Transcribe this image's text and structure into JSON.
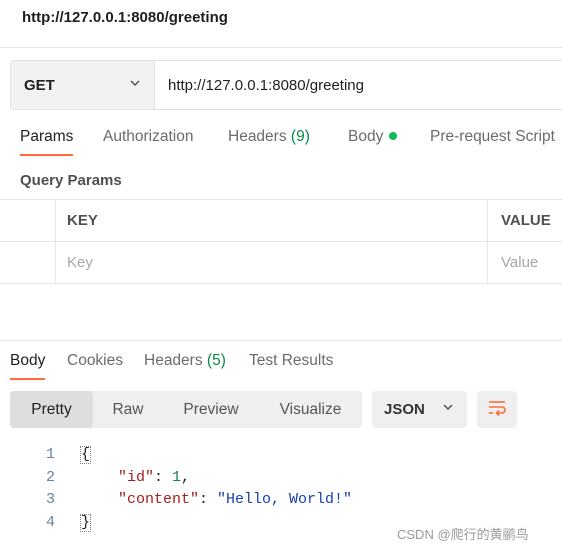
{
  "request": {
    "title": "http://127.0.0.1:8080/greeting",
    "method": "GET",
    "url": "http://127.0.0.1:8080/greeting"
  },
  "request_tabs": {
    "params": "Params",
    "authorization": "Authorization",
    "headers": "Headers",
    "headers_count": "(9)",
    "body": "Body",
    "prerequest": "Pre-request Script"
  },
  "query_params": {
    "label": "Query Params",
    "columns": {
      "key": "KEY",
      "value": "VALUE"
    },
    "placeholders": {
      "key": "Key",
      "value": "Value"
    }
  },
  "response_tabs": {
    "body": "Body",
    "cookies": "Cookies",
    "headers": "Headers",
    "headers_count": "(5)",
    "test_results": "Test Results"
  },
  "view_modes": {
    "pretty": "Pretty",
    "raw": "Raw",
    "preview": "Preview",
    "visualize": "Visualize",
    "active": "Pretty"
  },
  "format": "JSON",
  "response_lines": [
    {
      "num": "1",
      "text": "{"
    },
    {
      "num": "2",
      "key": "\"id\"",
      "colon": ": ",
      "value": "1",
      "tail": ","
    },
    {
      "num": "3",
      "key": "\"content\"",
      "colon": ": ",
      "value": "\"Hello, World!\""
    },
    {
      "num": "4",
      "text": "}"
    }
  ],
  "watermark": "CSDN @爬行的黄鹂鸟",
  "colors": {
    "accent": "#ff6c37",
    "status_green": "#0cbb52"
  },
  "icons": [
    "chevron-down-icon",
    "wrap-lines-icon"
  ]
}
